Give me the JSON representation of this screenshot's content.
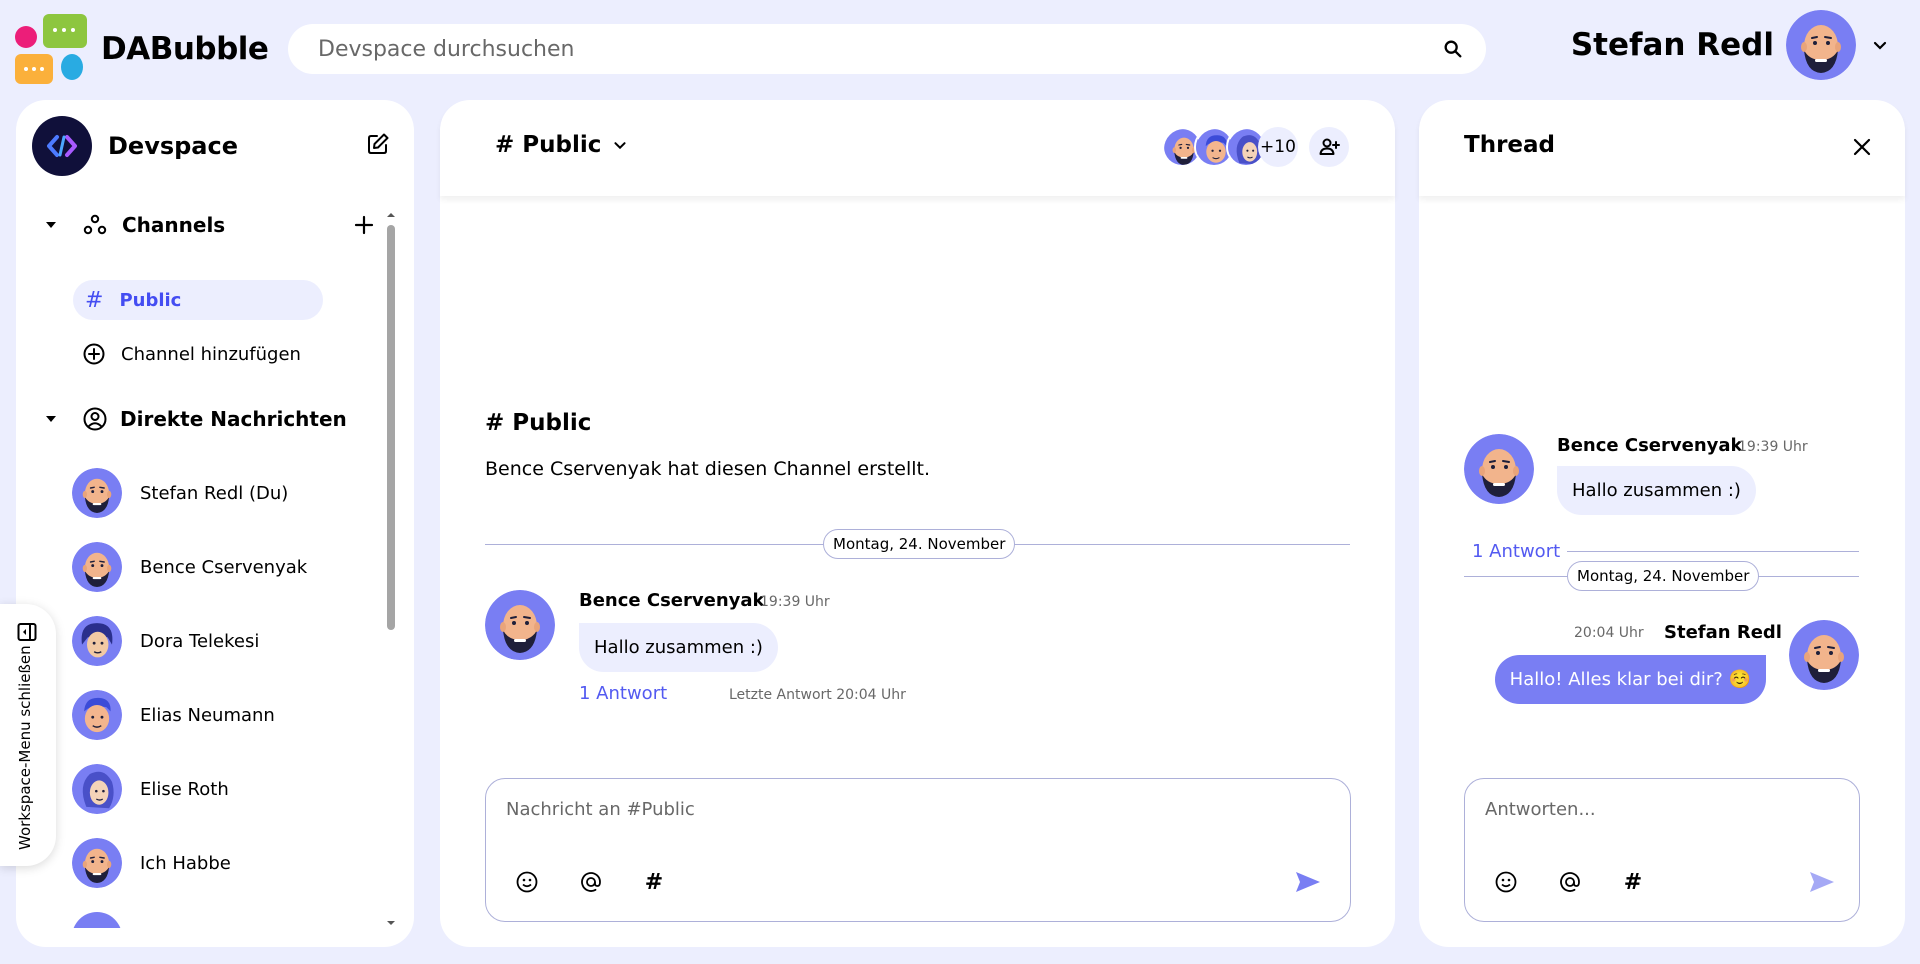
{
  "header": {
    "app_name": "DABubble",
    "search_placeholder": "Devspace durchsuchen",
    "user_name": "Stefan Redl"
  },
  "sidebar": {
    "workspace_name": "Devspace",
    "channels_title": "Channels",
    "active_channel_hash": "#",
    "active_channel": "Public",
    "add_channel": "Channel hinzufügen",
    "dm_title": "Direkte Nachrichten",
    "dms": [
      {
        "name": "Stefan Redl (Du)"
      },
      {
        "name": "Bence Cservenyak"
      },
      {
        "name": "Dora Telekesi"
      },
      {
        "name": "Elias Neumann"
      },
      {
        "name": "Elise Roth"
      },
      {
        "name": "Ich Habbe"
      }
    ],
    "toggle_label": "Workspace-Menu schließen"
  },
  "channel": {
    "title": "# Public",
    "member_overflow": "+10",
    "intro_title": "# Public",
    "intro_text": "Bence Cservenyak hat diesen Channel erstellt.",
    "date_label": "Montag, 24. November",
    "message": {
      "author": "Bence Cservenyak",
      "time": "19:39 Uhr",
      "text": "Hallo zusammen :)",
      "replies": "1 Antwort",
      "last_reply": "Letzte Antwort 20:04 Uhr"
    },
    "composer_placeholder": "Nachricht an #Public",
    "tool_hash": "#"
  },
  "thread": {
    "title": "Thread",
    "original": {
      "author": "Bence Cservenyak",
      "time": "19:39 Uhr",
      "text": "Hallo zusammen :)"
    },
    "reply_count": "1 Antwort",
    "date_label": "Montag, 24. November",
    "reply": {
      "author": "Stefan Redl",
      "time": "20:04 Uhr",
      "text": "Hallo! Alles klar bei dir? ☺️"
    },
    "composer_placeholder": "Antworten...",
    "tool_hash": "#"
  },
  "colors": {
    "background": "#eceefe",
    "accent": "#444df2",
    "bubble_own": "#797ef3",
    "border": "#adb0d9"
  }
}
